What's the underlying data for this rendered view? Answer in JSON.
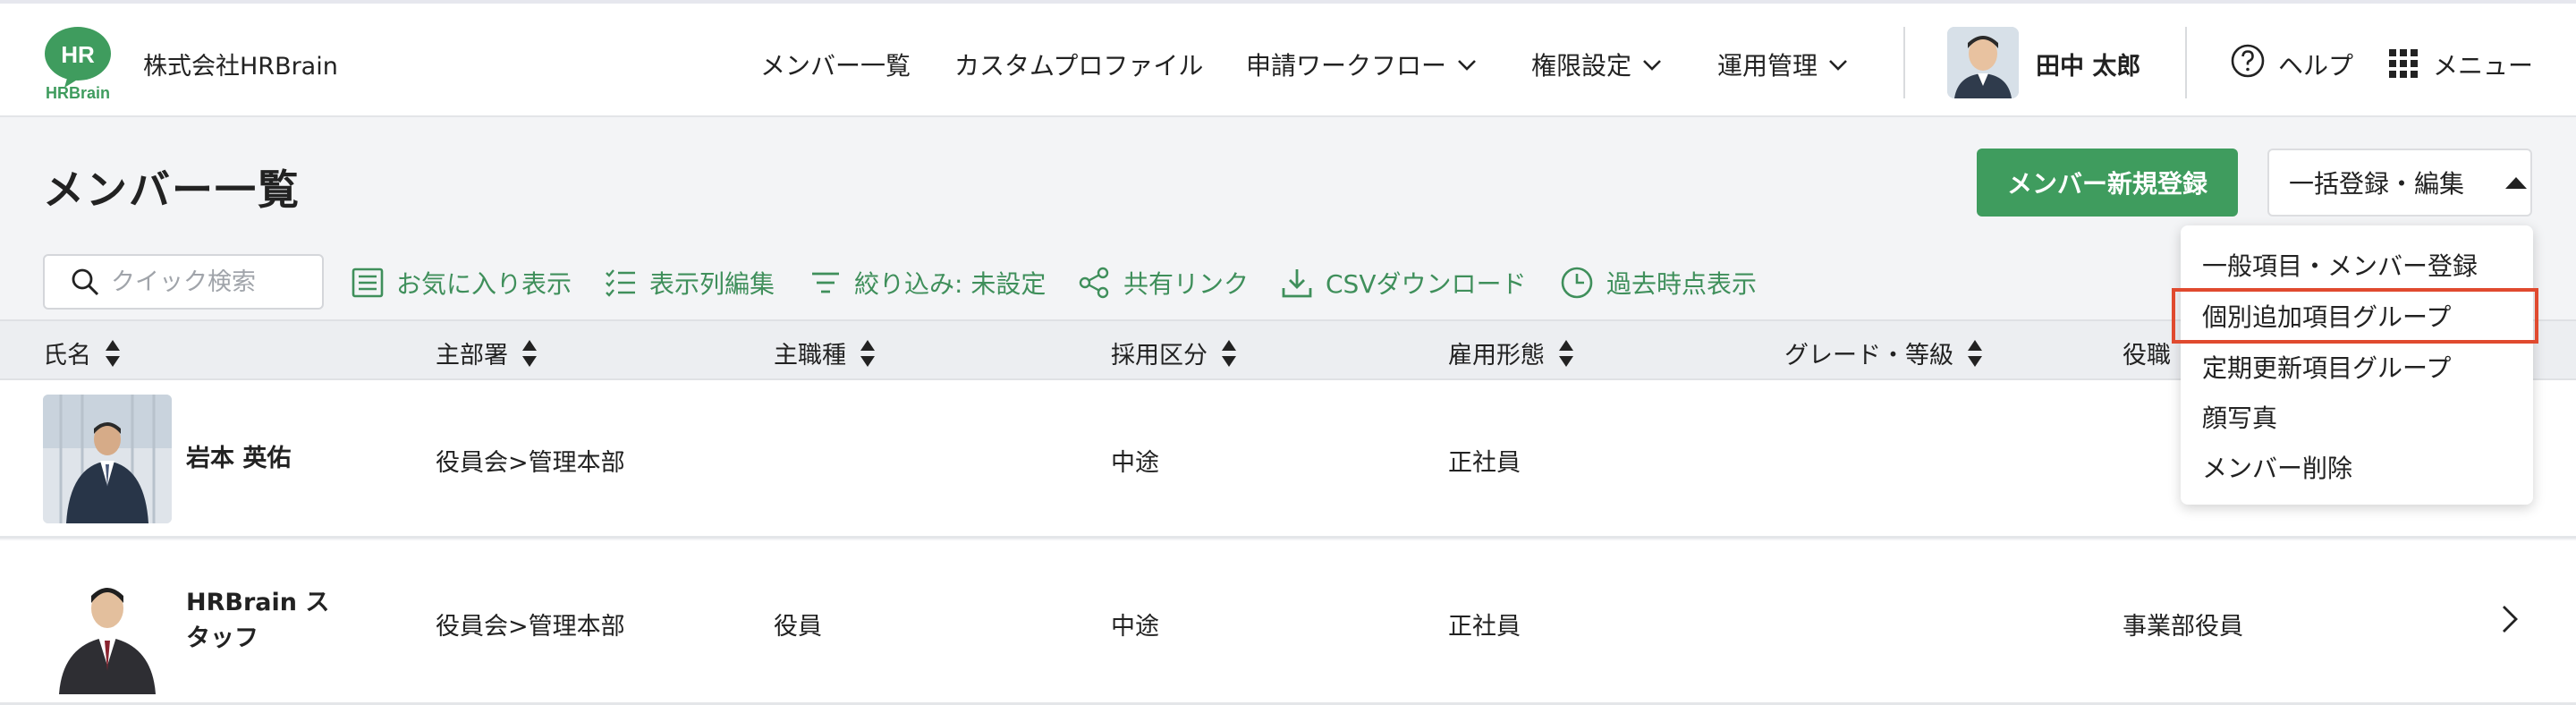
{
  "header": {
    "logo_text": "HR",
    "logo_sub": "HRBrain",
    "company": "株式会社HRBrain",
    "nav": [
      {
        "label": "メンバー一覧",
        "dropdown": false
      },
      {
        "label": "カスタムプロファイル",
        "dropdown": false
      },
      {
        "label": "申請ワークフロー",
        "dropdown": true
      },
      {
        "label": "権限設定",
        "dropdown": true
      },
      {
        "label": "運用管理",
        "dropdown": true
      }
    ],
    "user_name": "田中 太郎",
    "help_label": "ヘルプ",
    "menu_label": "メニュー"
  },
  "page": {
    "title": "メンバー一覧",
    "primary_button": "メンバー新規登録",
    "bulk_button": "一括登録・編集"
  },
  "toolbar": {
    "search_placeholder": "クイック検索",
    "favorites": "お気に入り表示",
    "columns": "表示列編集",
    "filter": "絞り込み: 未設定",
    "share": "共有リンク",
    "csv": "CSVダウンロード",
    "history": "過去時点表示"
  },
  "table": {
    "columns": [
      "氏名",
      "主部署",
      "主職種",
      "採用区分",
      "雇用形態",
      "グレード・等級",
      "役職"
    ],
    "rows": [
      {
        "name": "岩本 英佑",
        "department": "役員会>管理本部",
        "job": "",
        "hiring": "中途",
        "employment": "正社員",
        "grade": "",
        "position": ""
      },
      {
        "name_line1": "HRBrain ス",
        "name_line2": "タッフ",
        "department": "役員会>管理本部",
        "job": "役員",
        "hiring": "中途",
        "employment": "正社員",
        "grade": "",
        "position": "事業部役員"
      }
    ]
  },
  "dropdown": {
    "items": [
      "一般項目・メンバー登録",
      "個別追加項目グループ",
      "定期更新項目グループ",
      "顔写真",
      "メンバー削除"
    ],
    "highlighted_index": 1
  },
  "colors": {
    "accent_green": "#3f9c5e",
    "link_green": "#3f8f5b",
    "highlight_red": "#e04a2f"
  }
}
